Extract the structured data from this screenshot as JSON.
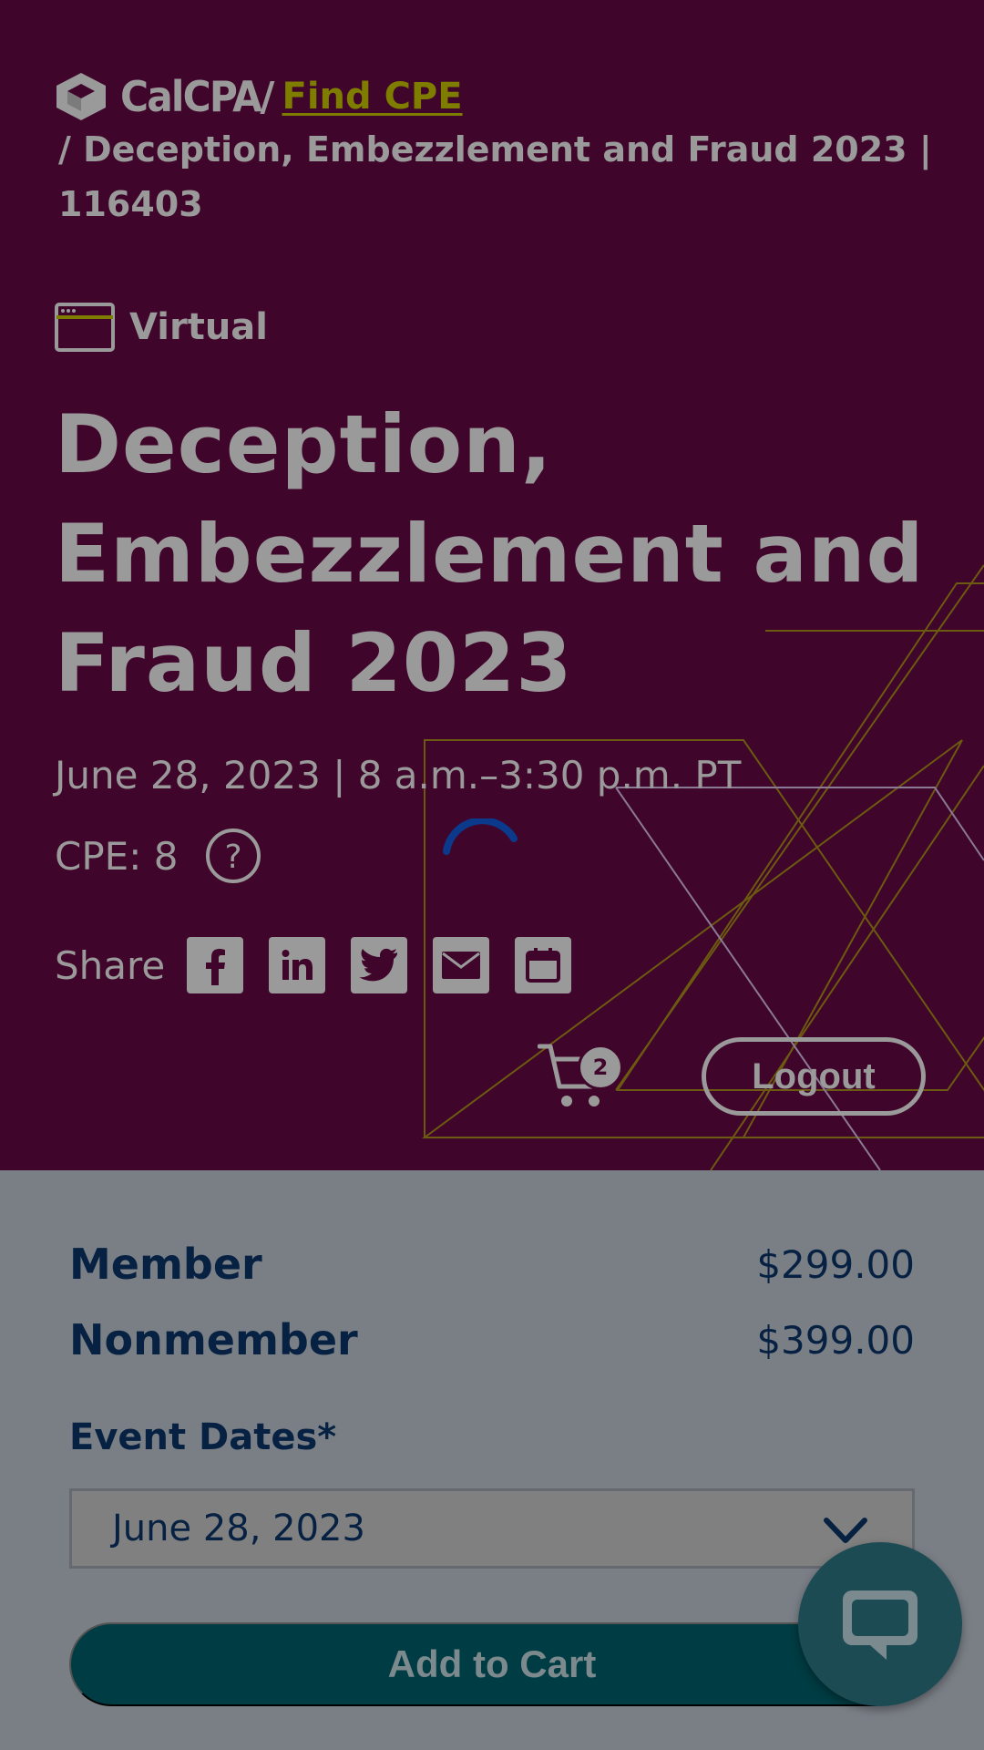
{
  "brand": {
    "logo_text": "CalCPA",
    "separator": "/"
  },
  "breadcrumb": {
    "find_cpe": "Find CPE",
    "current": "/ Deception, Embezzlement and Fraud 2023 | 116403"
  },
  "event": {
    "format": "Virtual",
    "title": "Deception, Embezzlement and Fraud 2023",
    "datetime": "June 28, 2023 | 8 a.m.–3:30 p.m. PT",
    "cpe": "CPE: 8"
  },
  "share": {
    "label": "Share",
    "icons": [
      "facebook-icon",
      "linkedin-icon",
      "twitter-icon",
      "email-icon",
      "calendar-icon"
    ]
  },
  "header": {
    "cart_count": "2",
    "logout_label": "Logout"
  },
  "pricing": [
    {
      "label": "Member",
      "price": "$299.00"
    },
    {
      "label": "Nonmember",
      "price": "$399.00"
    }
  ],
  "event_dates": {
    "label": "Event Dates*",
    "selected": "June 28, 2023"
  },
  "actions": {
    "add_to_cart": "Add to Cart"
  },
  "colors": {
    "hero_bg": "#40052a",
    "accent_link": "#7f7d00",
    "navy_text": "#072142",
    "cart_button": "#003c43",
    "spinner": "#0b3a8c"
  }
}
